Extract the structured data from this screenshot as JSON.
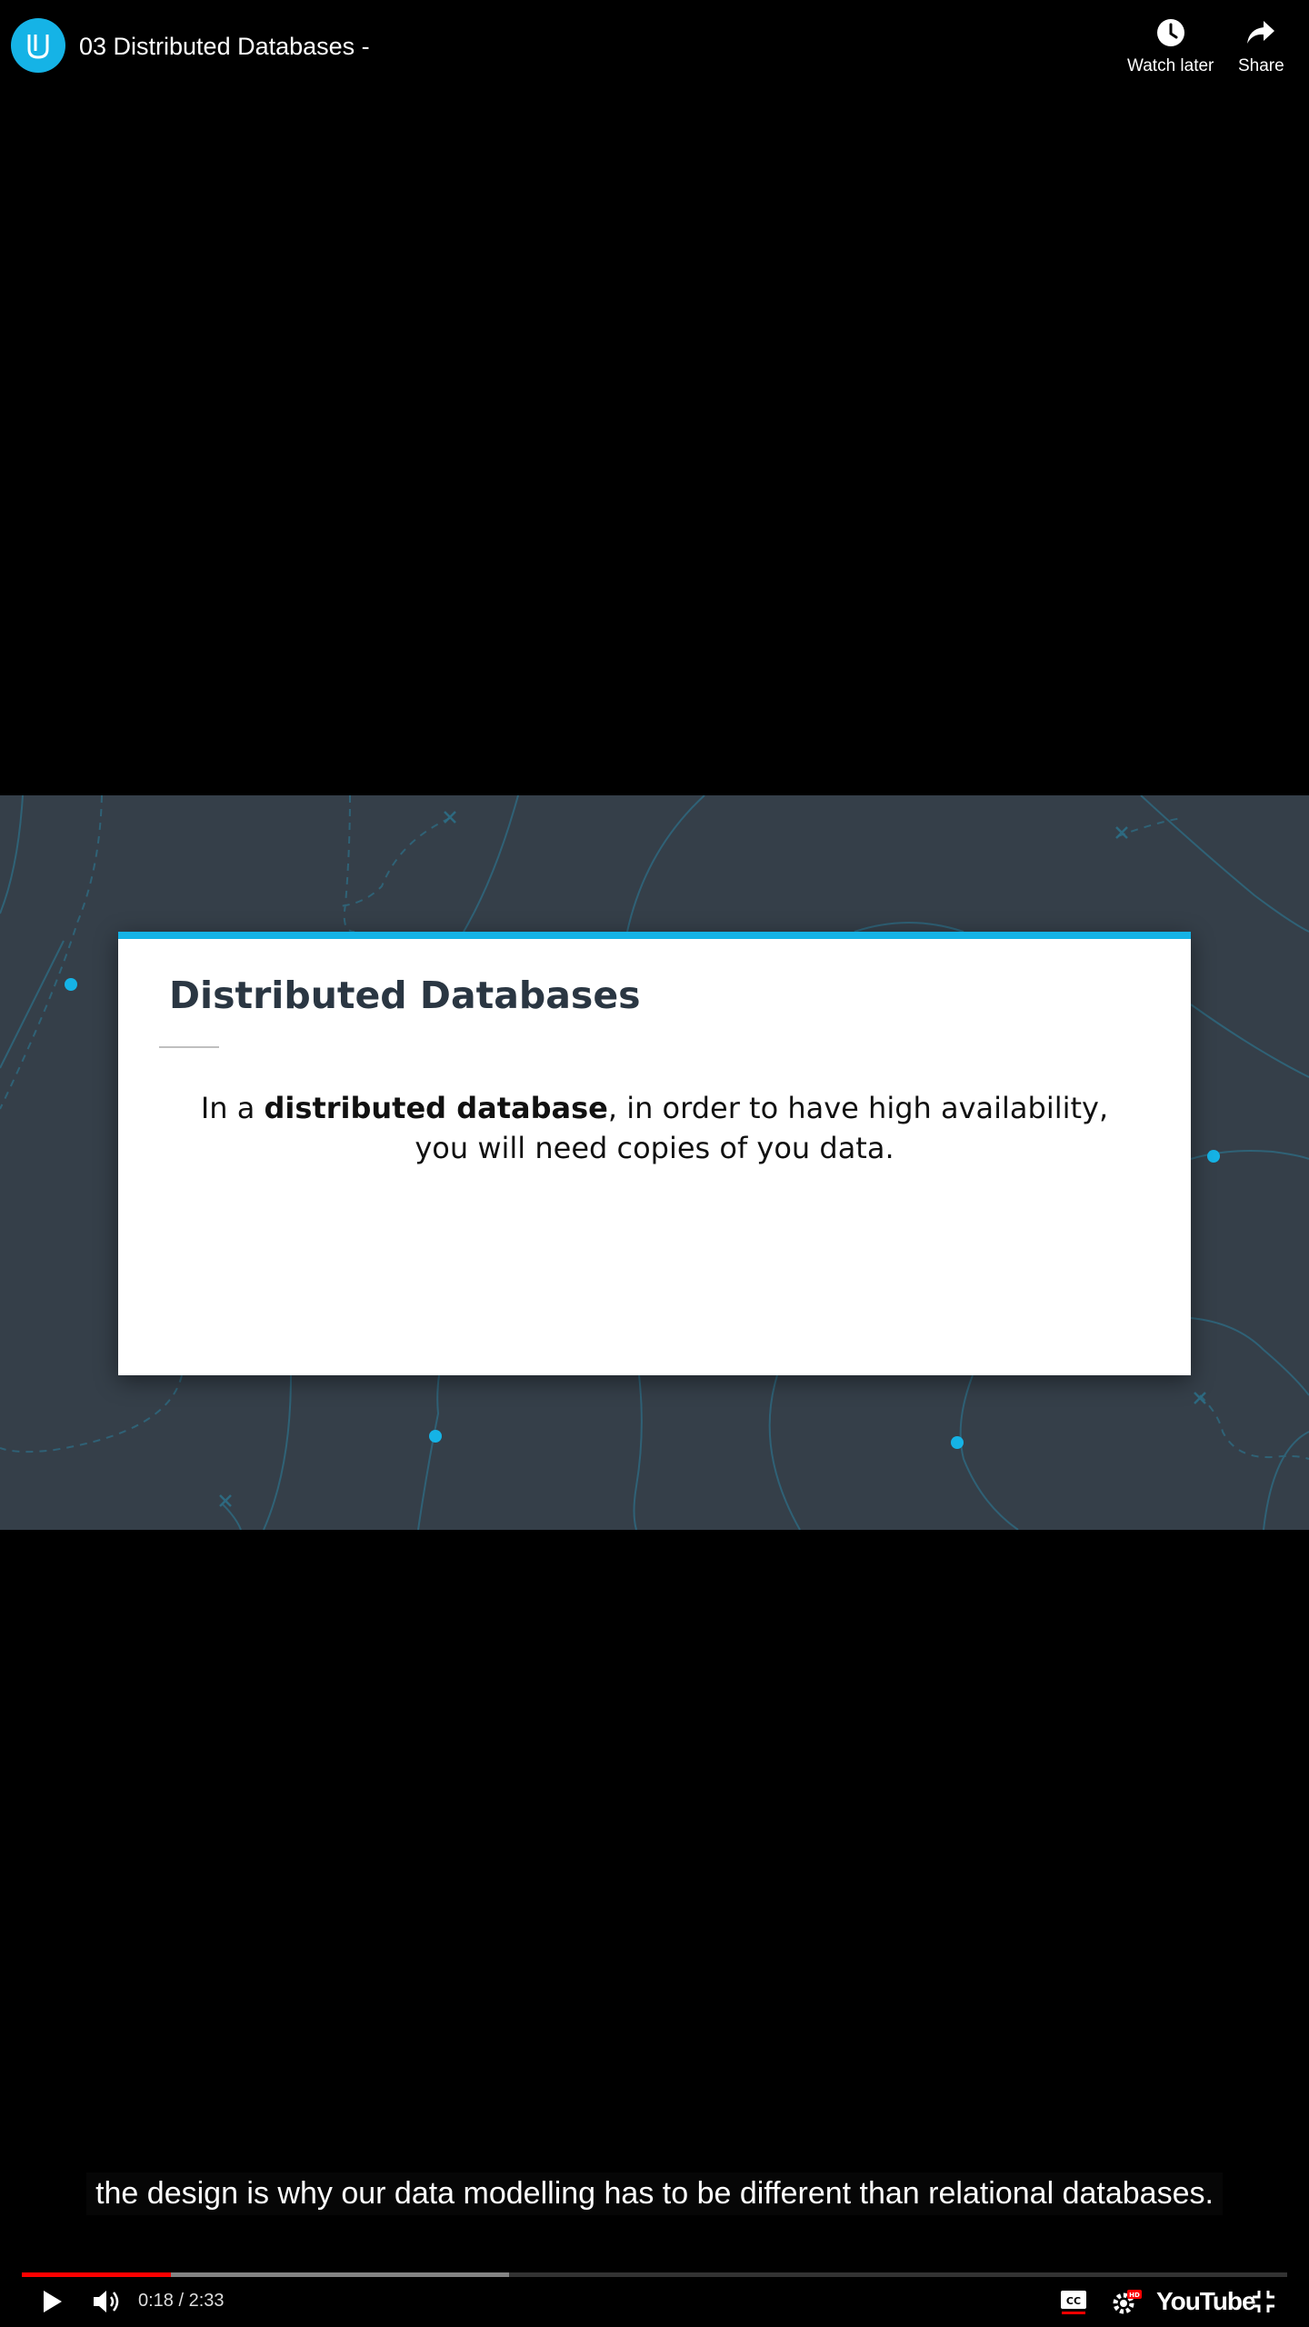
{
  "video": {
    "title": "03 Distributed Databases -",
    "channel_icon": "udacity-logo-icon"
  },
  "top_actions": {
    "watch_later": "Watch later",
    "share": "Share"
  },
  "slide": {
    "heading": "Distributed Databases",
    "body_prefix": "In a ",
    "body_bold": "distributed database",
    "body_suffix": ", in order to have high availability, you will need copies of you data.",
    "accent_color": "#15b3e6",
    "background_color": "#353f49"
  },
  "caption": "the design is why our data modelling has to be different than relational databases.",
  "player": {
    "time": "0:18 / 2:33",
    "progress_fraction": 0.1176,
    "buffered_fraction": 0.385,
    "logo_text": "YouTube",
    "icons": [
      "play-icon",
      "volume-icon",
      "captions-icon",
      "settings-hd-icon",
      "exit-fullscreen-icon"
    ]
  }
}
